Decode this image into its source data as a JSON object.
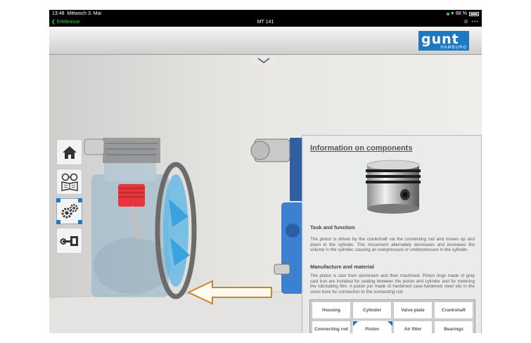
{
  "status_bar": {
    "time": "13:48",
    "date": "Mittwoch 3. Mai",
    "battery": "88 %"
  },
  "nav": {
    "back_label": "Erlebnisse",
    "title": "MT 141"
  },
  "logo": {
    "text": "gunt",
    "subtext": "HAMBURG"
  },
  "toolbar": {
    "items": [
      "home-icon",
      "glasses-book-icon",
      "gears-icon",
      "wrench-icon"
    ]
  },
  "panel": {
    "title": "Information on components",
    "section1_heading": "Task and function",
    "section1_text": "The piston is driven by the crankshaft via the connecting rod and moves up and down in the cylinder. This movement alternately decreases and increases the volume in the cylinder, causing an overpressure or underpressure in the cylinder.",
    "section2_heading": "Manufacture and material",
    "section2_text": "The piston is cast from aluminium and then machined. Piston rings made of grey cast iron are installed for sealing between the piston and cylinder and for metering the lubricating film. A piston pin made of hardened case-hardened steel sits in the cross bore for connection to the connecting rod."
  },
  "components": {
    "row1": [
      "Housing",
      "Cylinder",
      "Valve plate",
      "Crankshaft"
    ],
    "row2": [
      "Connecting rod",
      "Piston",
      "Air filter",
      "Bearings"
    ],
    "selected": "Piston"
  },
  "colors": {
    "brand_blue": "#1e7ac0",
    "status_green": "#3ecf4a",
    "highlight_red": "#e8343c"
  }
}
